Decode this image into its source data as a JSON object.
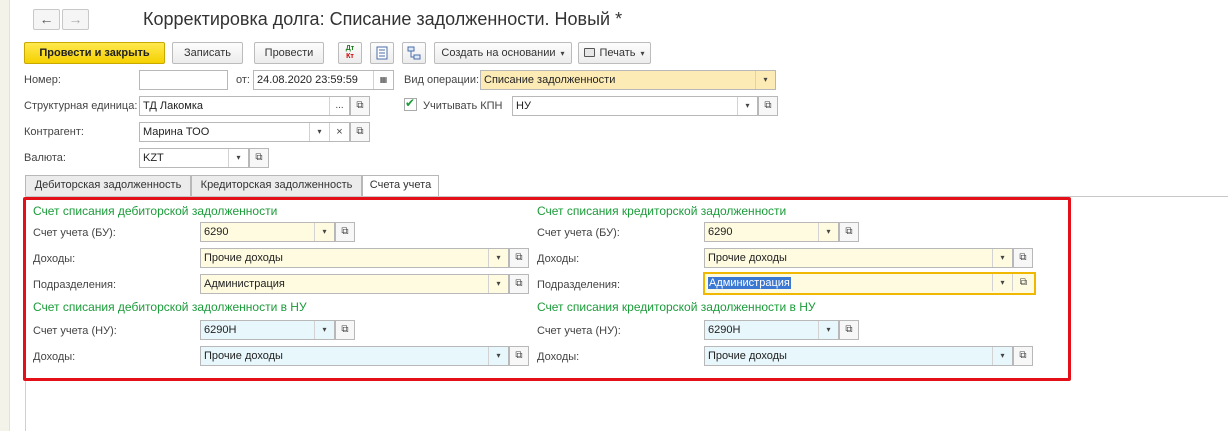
{
  "window": {
    "title": "Корректировка долга: Списание задолженности. Новый *"
  },
  "nav": {
    "back_icon": "arrow-left-icon",
    "forward_icon": "arrow-right-icon",
    "back_glyph": "←",
    "forward_glyph": "→"
  },
  "toolbar": {
    "post_close": "Провести и закрыть",
    "save": "Записать",
    "post": "Провести",
    "dt_kt_line1": "Дт",
    "dt_kt_line2": "Кт",
    "create_based": "Создать на основании",
    "print": "Печать"
  },
  "header": {
    "number_label": "Номер:",
    "number_value": "",
    "from_label": "от:",
    "date_value": "24.08.2020 23:59:59",
    "op_type_label": "Вид операции:",
    "op_type_value": "Списание задолженности",
    "struct_unit_label": "Структурная единица:",
    "struct_unit_value": "ТД Лакомка",
    "kpn_label": "Учитывать КПН",
    "kpn_checked": true,
    "kpn_value": "НУ",
    "contractor_label": "Контрагент:",
    "contractor_value": "Марина ТОО",
    "currency_label": "Валюта:",
    "currency_value": "KZT"
  },
  "tabs": [
    {
      "label": "Дебиторская задолженность"
    },
    {
      "label": "Кредиторская задолженность"
    },
    {
      "label": "Счета учета"
    }
  ],
  "debit": {
    "title": "Счет списания дебиторской задолженности",
    "account_bu_label": "Счет учета (БУ):",
    "account_bu_value": "6290",
    "income_label": "Доходы:",
    "income_value": "Прочие доходы",
    "division_label": "Подразделения:",
    "division_value": "Администрация",
    "nu_title": "Счет списания дебиторской задолженности в НУ",
    "account_nu_label": "Счет учета (НУ):",
    "account_nu_value": "6290Н",
    "income_nu_label": "Доходы:",
    "income_nu_value": "Прочие доходы"
  },
  "credit": {
    "title": "Счет списания кредиторской задолженности",
    "account_bu_label": "Счет учета (БУ):",
    "account_bu_value": "6290",
    "income_label": "Доходы:",
    "income_value": "Прочие доходы",
    "division_label": "Подразделения:",
    "division_value": "Администрация",
    "nu_title": "Счет списания кредиторской задолженности в НУ",
    "account_nu_label": "Счет учета (НУ):",
    "account_nu_value": "6290Н",
    "income_nu_label": "Доходы:",
    "income_nu_value": "Прочие доходы"
  },
  "glyphs": {
    "dropdown": "▾",
    "ellipsis": "...",
    "clear": "×",
    "open": "⧉",
    "check": "✔",
    "calendar": "▦"
  },
  "colors": {
    "accent_green": "#1b9b3a",
    "primary_yellow": "#f5d000",
    "highlight_red": "#e3101a"
  }
}
